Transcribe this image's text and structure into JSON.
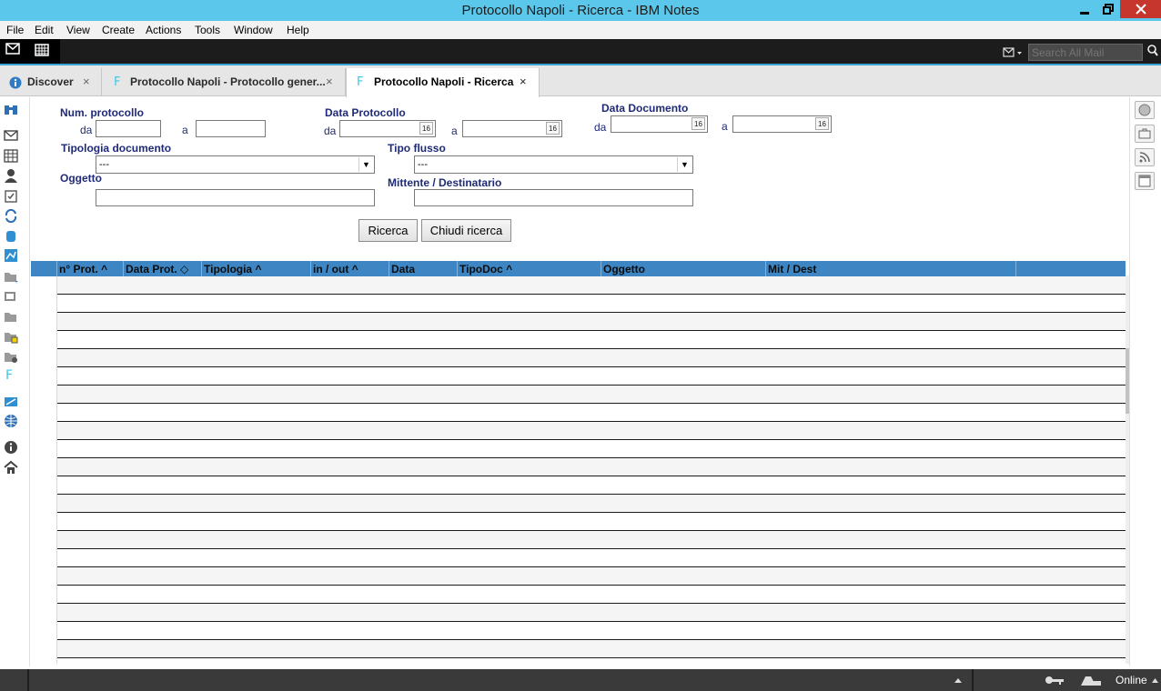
{
  "window": {
    "title": "Protocollo Napoli - Ricerca - IBM Notes",
    "buttons": {
      "minimize": "▁",
      "maximize": "❐",
      "close": "✕"
    }
  },
  "menu": [
    "File",
    "Edit",
    "View",
    "Create",
    "Actions",
    "Tools",
    "Window",
    "Help"
  ],
  "toolbar": {
    "search_placeholder": "Search All Mail"
  },
  "tabs": [
    {
      "label": "Discover",
      "icon": "info-icon",
      "close": "×"
    },
    {
      "label": "Protocollo Napoli - Protocollo gener...",
      "icon": "F",
      "close": "×"
    },
    {
      "label": "Protocollo Napoli - Ricerca",
      "icon": "F",
      "close": "×",
      "active": true
    }
  ],
  "form": {
    "num_protocollo": {
      "label": "Num. protocollo",
      "from": "da",
      "to": "a",
      "from_value": "",
      "to_value": ""
    },
    "data_protocollo": {
      "label": "Data Protocollo",
      "from": "da",
      "to": "a",
      "cal": "16"
    },
    "data_documento": {
      "label": "Data Documento",
      "from": "da",
      "to": "a",
      "cal": "16"
    },
    "tipologia": {
      "label": "Tipologia documento",
      "value": "---"
    },
    "tipo_flusso": {
      "label": "Tipo flusso",
      "value": "---"
    },
    "oggetto": {
      "label": "Oggetto",
      "value": ""
    },
    "mittente": {
      "label": "Mittente / Destinatario",
      "value": ""
    },
    "buttons": {
      "search": "Ricerca",
      "close_search": "Chiudi ricerca"
    }
  },
  "grid": {
    "columns": [
      {
        "label": "n° Prot.",
        "sort": "^"
      },
      {
        "label": "Data Prot.",
        "sort": "◇"
      },
      {
        "label": "Tipologia",
        "sort": "^"
      },
      {
        "label": "in / out",
        "sort": "^"
      },
      {
        "label": "Data",
        "sort": ""
      },
      {
        "label": "TipoDoc",
        "sort": "^"
      },
      {
        "label": "Oggetto",
        "sort": ""
      },
      {
        "label": "Mit / Dest",
        "sort": ""
      }
    ],
    "rows": []
  },
  "status": {
    "online": "Online"
  },
  "colors": {
    "titlebar": "#5bc8eb",
    "grid_header": "#3e86c3",
    "label": "#1f2a78",
    "accent": "#3aa3d4"
  }
}
